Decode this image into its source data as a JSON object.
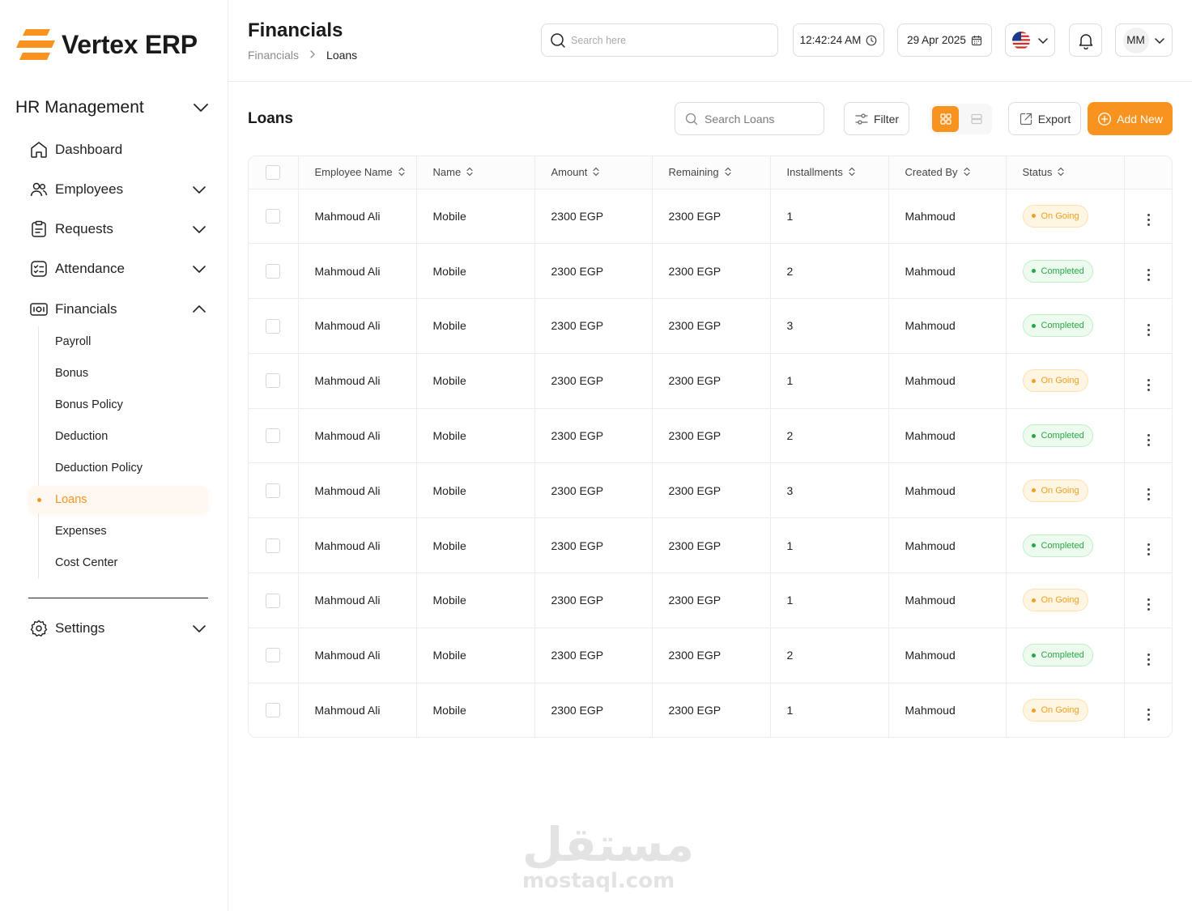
{
  "app": {
    "name": "Vertex ERP"
  },
  "sidebar": {
    "module_title": "HR Management",
    "items": [
      {
        "label": "Dashboard",
        "icon": "home-icon"
      },
      {
        "label": "Employees",
        "icon": "users-icon"
      },
      {
        "label": "Requests",
        "icon": "clipboard-icon"
      },
      {
        "label": "Attendance",
        "icon": "checklist-icon"
      },
      {
        "label": "Financials",
        "icon": "money-icon"
      }
    ],
    "financials_sub": [
      {
        "label": "Payroll"
      },
      {
        "label": "Bonus"
      },
      {
        "label": "Bonus Policy"
      },
      {
        "label": "Deduction"
      },
      {
        "label": "Deduction Policy"
      },
      {
        "label": "Loans",
        "active": true
      },
      {
        "label": "Expenses"
      },
      {
        "label": "Cost Center"
      }
    ],
    "settings_label": "Settings"
  },
  "header": {
    "title": "Financials",
    "breadcrumb": [
      "Financials",
      "Loans"
    ],
    "search_placeholder": "Search here",
    "time": "12:42:24 AM",
    "date": "29 Apr 2025",
    "user_initials": "MM"
  },
  "content": {
    "title": "Loans",
    "search_placeholder": "Search Loans",
    "filter_label": "Filter",
    "export_label": "Export",
    "add_label": "Add New",
    "accent_color": "#f7931e"
  },
  "table": {
    "columns": [
      "Employee Name",
      "Name",
      "Amount",
      "Remaining",
      "Installments",
      "Created By",
      "Status"
    ],
    "rows": [
      {
        "employee": "Mahmoud Ali",
        "name": "Mobile",
        "amount": "2300 EGP",
        "remaining": "2300 EGP",
        "installments": "1",
        "created_by": "Mahmoud",
        "status": "On Going",
        "status_type": "ongoing"
      },
      {
        "employee": "Mahmoud Ali",
        "name": "Mobile",
        "amount": "2300 EGP",
        "remaining": "2300 EGP",
        "installments": "2",
        "created_by": "Mahmoud",
        "status": "Completed",
        "status_type": "completed"
      },
      {
        "employee": "Mahmoud Ali",
        "name": "Mobile",
        "amount": "2300 EGP",
        "remaining": "2300 EGP",
        "installments": "3",
        "created_by": "Mahmoud",
        "status": "Completed",
        "status_type": "completed"
      },
      {
        "employee": "Mahmoud Ali",
        "name": "Mobile",
        "amount": "2300 EGP",
        "remaining": "2300 EGP",
        "installments": "1",
        "created_by": "Mahmoud",
        "status": "On Going",
        "status_type": "ongoing"
      },
      {
        "employee": "Mahmoud Ali",
        "name": "Mobile",
        "amount": "2300 EGP",
        "remaining": "2300 EGP",
        "installments": "2",
        "created_by": "Mahmoud",
        "status": "Completed",
        "status_type": "completed"
      },
      {
        "employee": "Mahmoud Ali",
        "name": "Mobile",
        "amount": "2300 EGP",
        "remaining": "2300 EGP",
        "installments": "3",
        "created_by": "Mahmoud",
        "status": "On Going",
        "status_type": "ongoing"
      },
      {
        "employee": "Mahmoud Ali",
        "name": "Mobile",
        "amount": "2300 EGP",
        "remaining": "2300 EGP",
        "installments": "1",
        "created_by": "Mahmoud",
        "status": "Completed",
        "status_type": "completed"
      },
      {
        "employee": "Mahmoud Ali",
        "name": "Mobile",
        "amount": "2300 EGP",
        "remaining": "2300 EGP",
        "installments": "1",
        "created_by": "Mahmoud",
        "status": "On Going",
        "status_type": "ongoing"
      },
      {
        "employee": "Mahmoud Ali",
        "name": "Mobile",
        "amount": "2300 EGP",
        "remaining": "2300 EGP",
        "installments": "2",
        "created_by": "Mahmoud",
        "status": "Completed",
        "status_type": "completed"
      },
      {
        "employee": "Mahmoud Ali",
        "name": "Mobile",
        "amount": "2300 EGP",
        "remaining": "2300 EGP",
        "installments": "1",
        "created_by": "Mahmoud",
        "status": "On Going",
        "status_type": "ongoing"
      }
    ]
  },
  "watermark": {
    "arabic": "مستقل",
    "latin": "mostaql.com"
  }
}
